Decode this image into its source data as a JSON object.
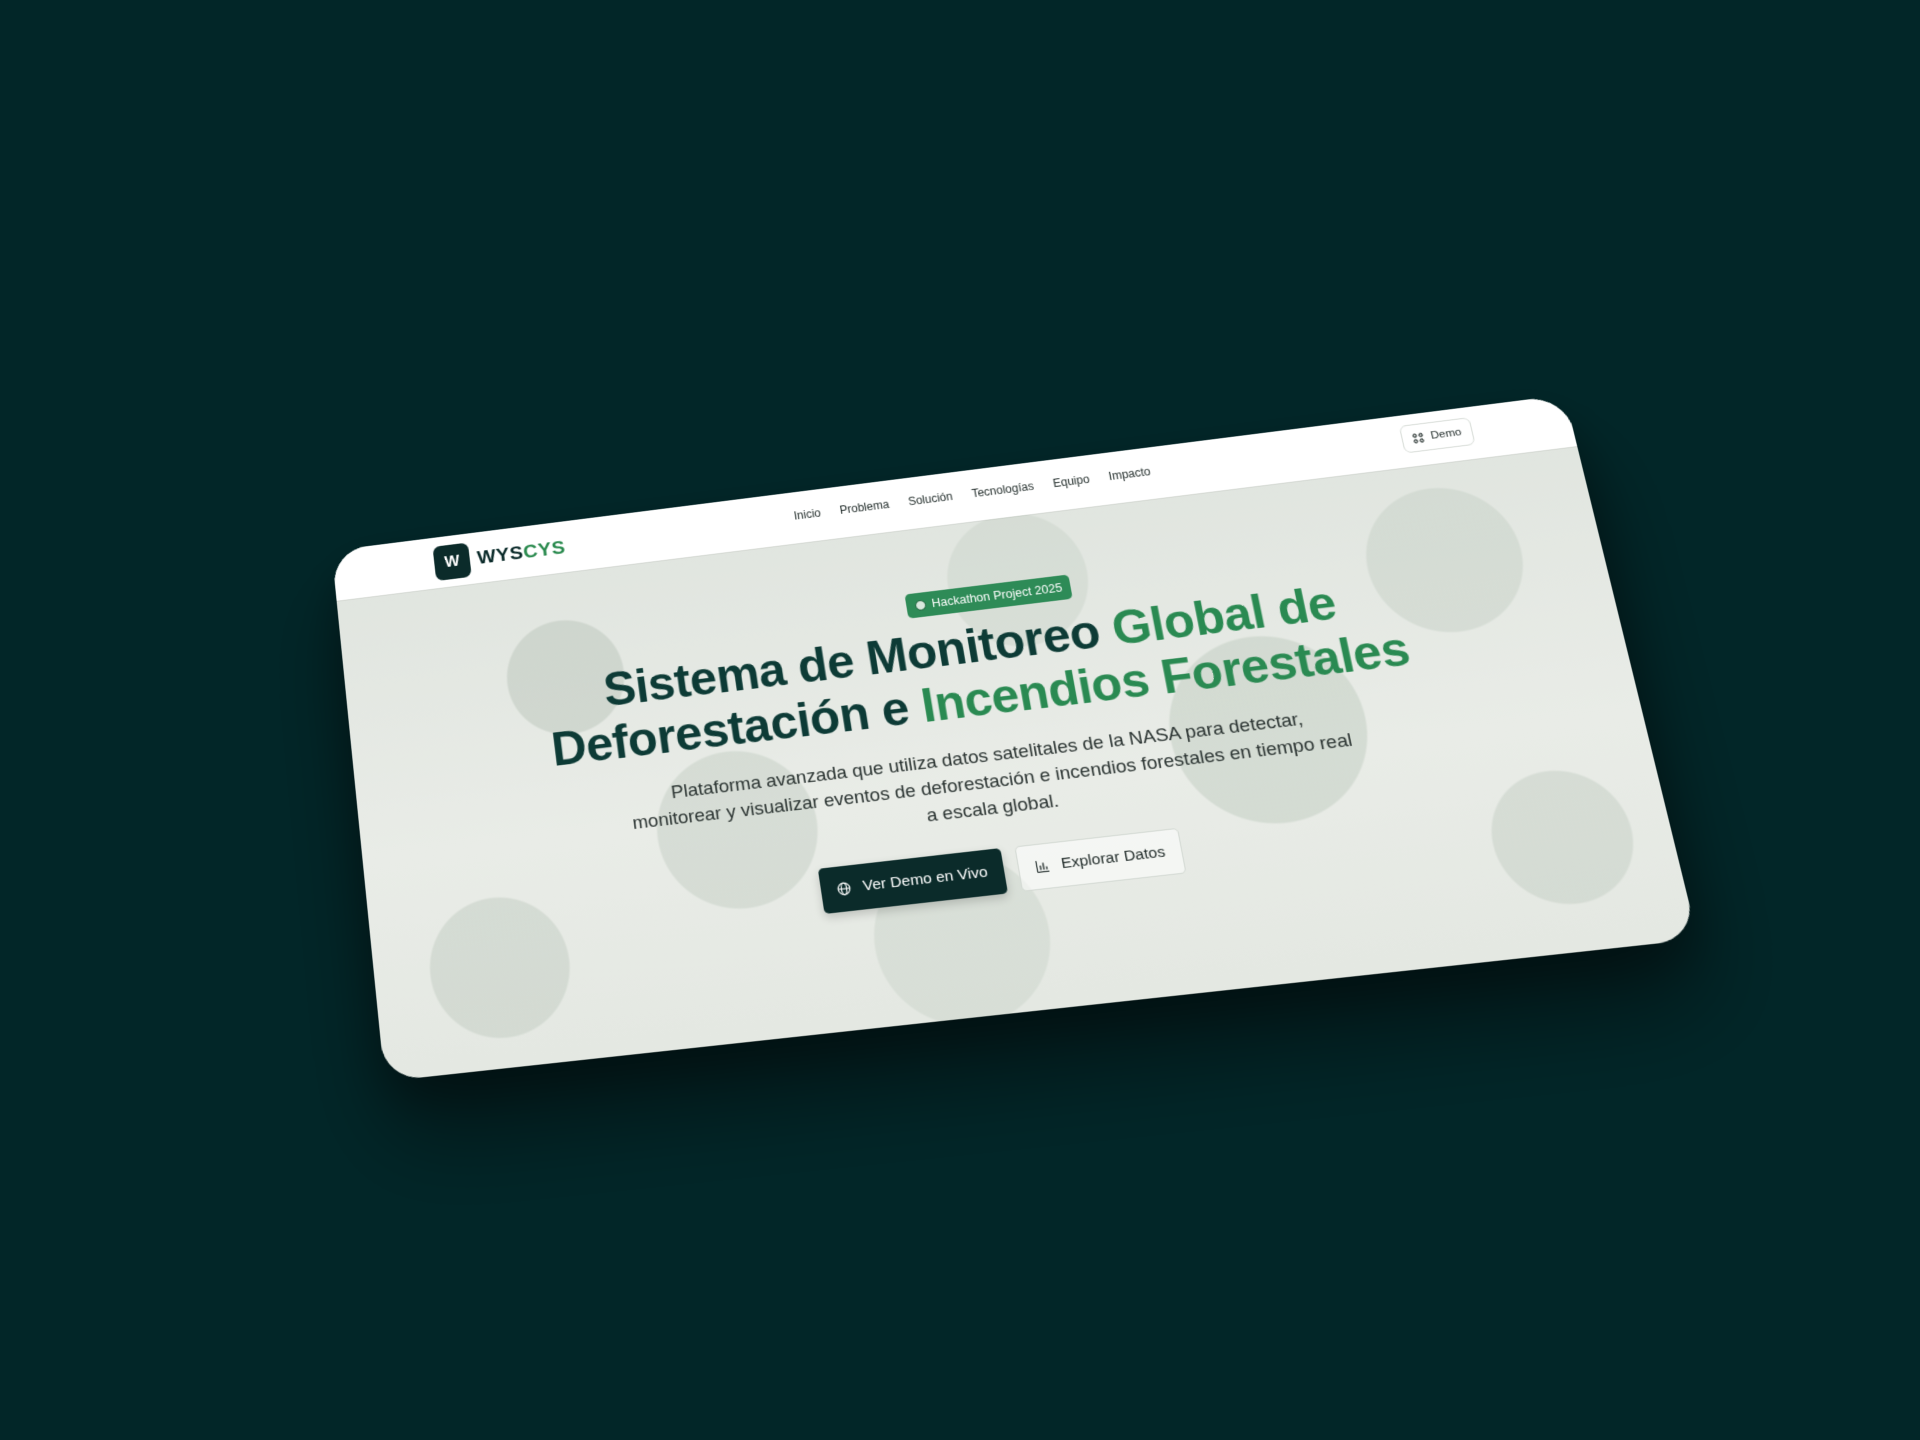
{
  "brand": {
    "mark": "W",
    "name_part1": "WYS",
    "name_part2": "CYS"
  },
  "nav": {
    "items": [
      {
        "label": "Inicio"
      },
      {
        "label": "Problema"
      },
      {
        "label": "Solución"
      },
      {
        "label": "Tecnologías"
      },
      {
        "label": "Equipo"
      },
      {
        "label": "Impacto"
      }
    ],
    "demo_label": "Demo"
  },
  "hero": {
    "badge": "Hackathon Project 2025",
    "headline_dark_1": "Sistema de Monitoreo",
    "headline_green_1": "Global de",
    "headline_dark_2": "Deforestación e",
    "headline_green_2": "Incendios Forestales",
    "subtitle": "Plataforma avanzada que utiliza datos satelitales de la NASA para detectar, monitorear y visualizar eventos de deforestación e incendios forestales en tiempo real a escala global.",
    "primary_button": "Ver Demo en Vivo",
    "secondary_button": "Explorar Datos"
  },
  "colors": {
    "page_background": "#022628",
    "brand_dark": "#0b2b2a",
    "brand_green": "#2a8a52",
    "badge_green": "#2e8b57"
  },
  "icons": {
    "demo": "grid-icon",
    "primary": "globe-icon",
    "secondary": "bar-chart-icon",
    "badge": "dot-icon"
  }
}
